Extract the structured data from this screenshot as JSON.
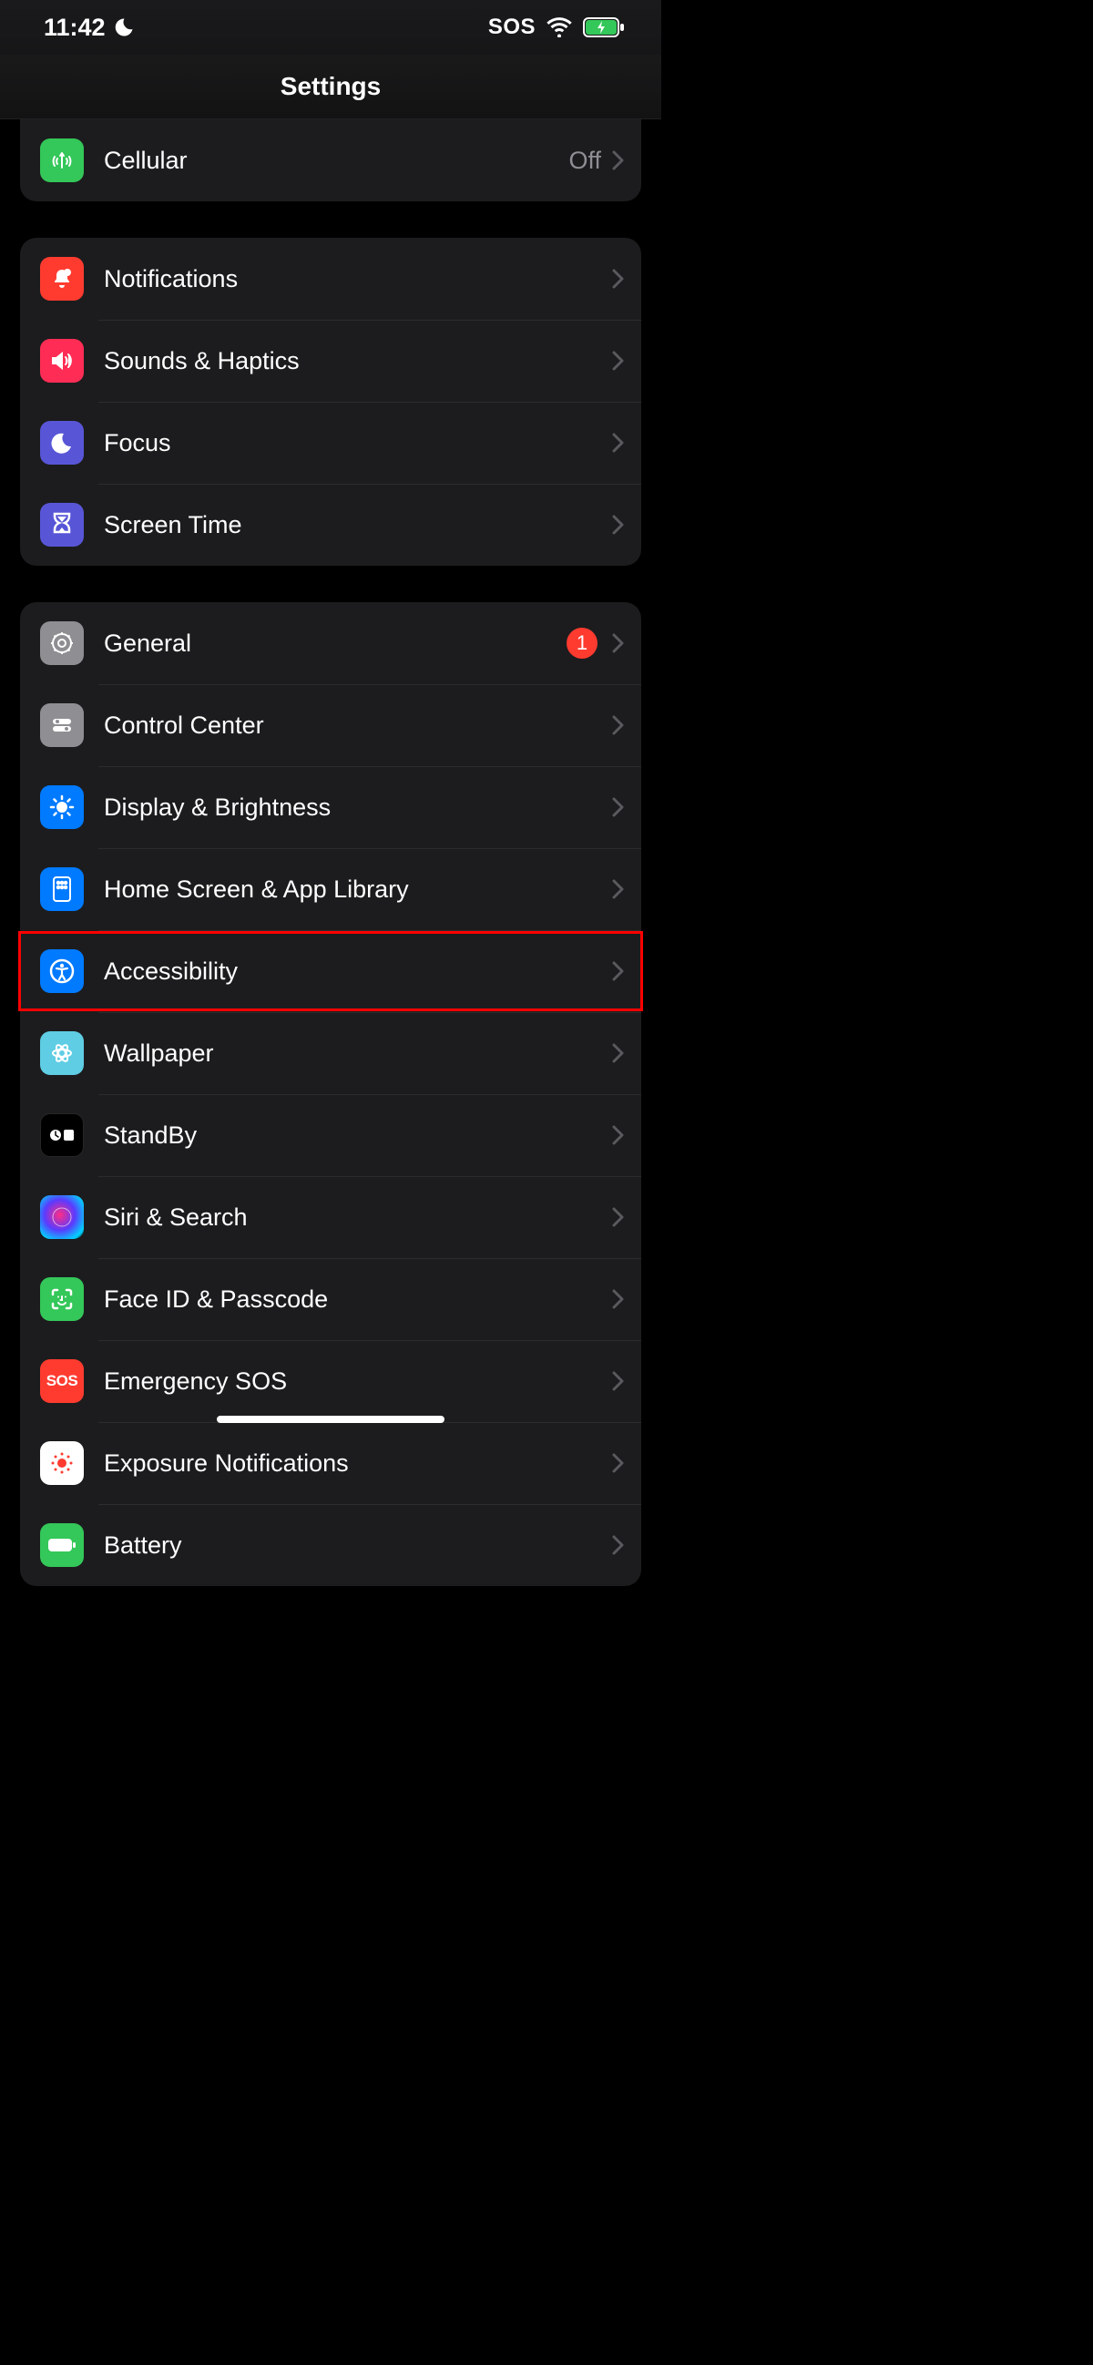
{
  "status": {
    "time": "11:42",
    "sos": "SOS"
  },
  "header": {
    "title": "Settings"
  },
  "group1": {
    "cellular": {
      "label": "Cellular",
      "value": "Off"
    }
  },
  "group2": {
    "notifications": {
      "label": "Notifications"
    },
    "sounds": {
      "label": "Sounds & Haptics"
    },
    "focus": {
      "label": "Focus"
    },
    "screentime": {
      "label": "Screen Time"
    }
  },
  "group3": {
    "general": {
      "label": "General",
      "badge": "1"
    },
    "controlcenter": {
      "label": "Control Center"
    },
    "display": {
      "label": "Display & Brightness"
    },
    "homescreen": {
      "label": "Home Screen & App Library"
    },
    "accessibility": {
      "label": "Accessibility"
    },
    "wallpaper": {
      "label": "Wallpaper"
    },
    "standby": {
      "label": "StandBy"
    },
    "siri": {
      "label": "Siri & Search"
    },
    "faceid": {
      "label": "Face ID & Passcode"
    },
    "sos": {
      "label": "Emergency SOS",
      "icon_text": "SOS"
    },
    "exposure": {
      "label": "Exposure Notifications"
    },
    "battery": {
      "label": "Battery"
    }
  },
  "highlight": {
    "target": "accessibility"
  }
}
